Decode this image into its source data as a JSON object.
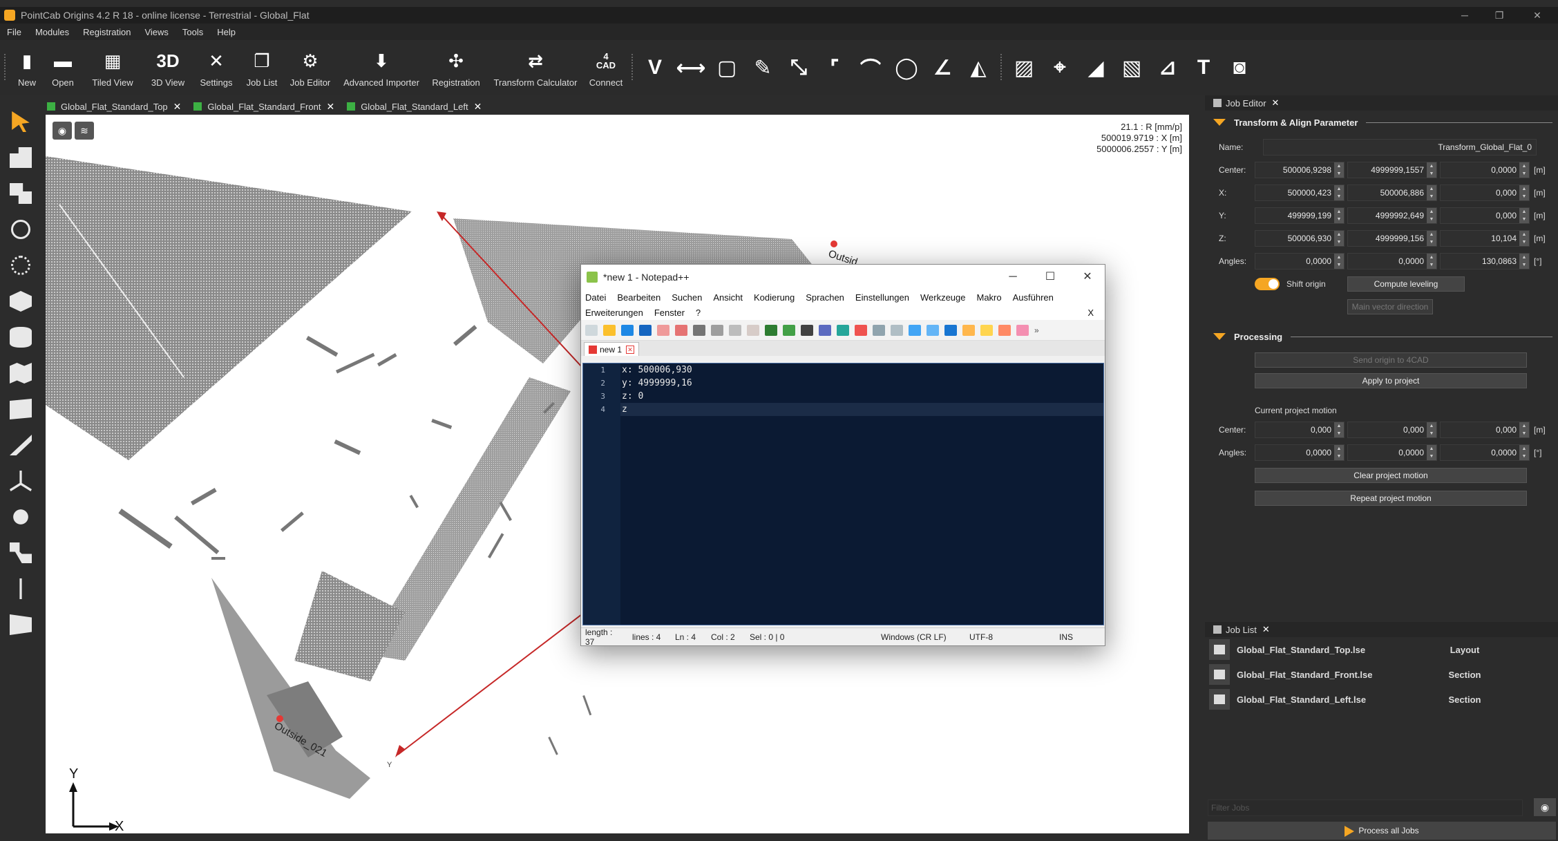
{
  "window": {
    "title": "PointCab Origins 4.2 R 18 - online license - Terrestrial - Global_Flat"
  },
  "menu": [
    "File",
    "Modules",
    "Registration",
    "Views",
    "Tools",
    "Help"
  ],
  "toolbar": {
    "buttons": [
      {
        "label": "New",
        "glyph": "▮"
      },
      {
        "label": "Open",
        "glyph": "▬"
      },
      {
        "label": "Tiled View",
        "glyph": "▦"
      },
      {
        "label": "3D View",
        "glyph": "3D"
      },
      {
        "label": "Settings",
        "glyph": "✕"
      },
      {
        "label": "Job List",
        "glyph": "❐"
      },
      {
        "label": "Job Editor",
        "glyph": "⚙"
      },
      {
        "label": "Advanced Importer",
        "glyph": "⬇"
      },
      {
        "label": "Registration",
        "glyph": "✣"
      },
      {
        "label": "Transform Calculator",
        "glyph": "⇄"
      },
      {
        "label": "Connect",
        "glyph": "4\nCAD"
      }
    ]
  },
  "tabs": [
    "Global_Flat_Standard_Top",
    "Global_Flat_Standard_Front",
    "Global_Flat_Standard_Left"
  ],
  "viewport": {
    "scale": "21.1 : R [mm/p]",
    "x_coord": "500019.9719 : X [m]",
    "y_coord": "5000006.2557 : Y [m]",
    "label_outside_021": "Outside_021",
    "label_outside": "Outsid",
    "axis_y": "Y",
    "axis_x": "X",
    "small_y": "Y"
  },
  "notepad": {
    "title": "*new 1 - Notepad++",
    "menu1": [
      "Datei",
      "Bearbeiten",
      "Suchen",
      "Ansicht",
      "Kodierung",
      "Sprachen",
      "Einstellungen",
      "Werkzeuge",
      "Makro",
      "Ausführen"
    ],
    "menu2": [
      "Erweiterungen",
      "Fenster",
      "?"
    ],
    "menu_close": "X",
    "tab": "new 1",
    "lines": [
      {
        "n": "1",
        "text": "x: 500006,930"
      },
      {
        "n": "2",
        "text": "y: 4999999,16"
      },
      {
        "n": "3",
        "text": "z: 0"
      },
      {
        "n": "4",
        "text": "z"
      }
    ],
    "status": {
      "length": "length : 37",
      "lines": "lines : 4",
      "ln": "Ln : 4",
      "col": "Col : 2",
      "sel": "Sel : 0 | 0",
      "eol": "Windows (CR LF)",
      "enc": "UTF-8",
      "mode": "INS"
    }
  },
  "job_editor": {
    "title": "Job Editor",
    "section1": "Transform & Align Parameter",
    "name_label": "Name:",
    "name_value": "Transform_Global_Flat_0",
    "rows": [
      {
        "label": "Center:",
        "v1": "500006,9298",
        "v2": "4999999,1557",
        "v3": "0,0000",
        "unit": "[m]"
      },
      {
        "label": "X:",
        "v1": "500000,423",
        "v2": "500006,886",
        "v3": "0,000",
        "unit": "[m]"
      },
      {
        "label": "Y:",
        "v1": "499999,199",
        "v2": "4999992,649",
        "v3": "0,000",
        "unit": "[m]"
      },
      {
        "label": "Z:",
        "v1": "500006,930",
        "v2": "4999999,156",
        "v3": "10,104",
        "unit": "[m]"
      },
      {
        "label": "Angles:",
        "v1": "0,0000",
        "v2": "0,0000",
        "v3": "130,0863",
        "unit": "[°]"
      }
    ],
    "shift_origin": "Shift origin",
    "compute_leveling": "Compute leveling",
    "main_vector": "Main vector direction",
    "section2": "Processing",
    "send_origin": "Send origin to 4CAD",
    "apply": "Apply to project",
    "current_motion": "Current project motion",
    "motion_rows": [
      {
        "label": "Center:",
        "v1": "0,000",
        "v2": "0,000",
        "v3": "0,000",
        "unit": "[m]"
      },
      {
        "label": "Angles:",
        "v1": "0,0000",
        "v2": "0,0000",
        "v3": "0,0000",
        "unit": "[°]"
      }
    ],
    "clear_motion": "Clear project motion",
    "repeat_motion": "Repeat project motion"
  },
  "job_list": {
    "title": "Job List",
    "jobs": [
      {
        "name": "Global_Flat_Standard_Top.lse",
        "type": "Layout"
      },
      {
        "name": "Global_Flat_Standard_Front.lse",
        "type": "Section"
      },
      {
        "name": "Global_Flat_Standard_Left.lse",
        "type": "Section"
      }
    ],
    "filter_placeholder": "Filter Jobs",
    "process_all": "Process all Jobs"
  },
  "colors": {
    "accent": "#f5a623",
    "tab_icon": "#3cb043",
    "line_red": "#c62828"
  }
}
